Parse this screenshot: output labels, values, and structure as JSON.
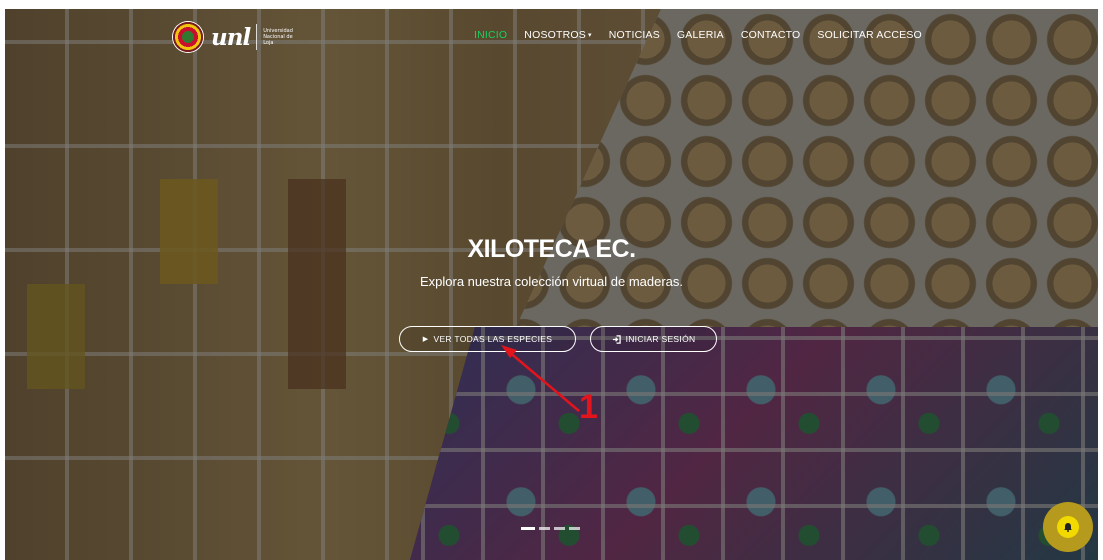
{
  "header": {
    "logo_text": "unl",
    "university_name": "Universidad Nacional de Loja"
  },
  "nav": {
    "items": [
      {
        "label": "INICIO",
        "active": true
      },
      {
        "label": "NOSOTROS",
        "has_dropdown": true
      },
      {
        "label": "NOTICIAS"
      },
      {
        "label": "GALERIA"
      },
      {
        "label": "CONTACTO"
      },
      {
        "label": "SOLICITAR ACCESO"
      }
    ],
    "active_color": "#18d25c"
  },
  "hero": {
    "title": "XILOTECA EC.",
    "subtitle": "Explora nuestra colección virtual de maderas.",
    "buttons": {
      "species": {
        "label": "VER TODAS LAS ESPECIES",
        "icon": "play-icon"
      },
      "login": {
        "label": "INICIAR SESIÓN",
        "icon": "sign-in-icon"
      }
    }
  },
  "annotation": {
    "number": "1",
    "color": "#e3141b"
  },
  "carousel": {
    "count": 4,
    "active_index": 0
  },
  "notification": {
    "icon": "bell-icon",
    "color": "#f2da00"
  }
}
